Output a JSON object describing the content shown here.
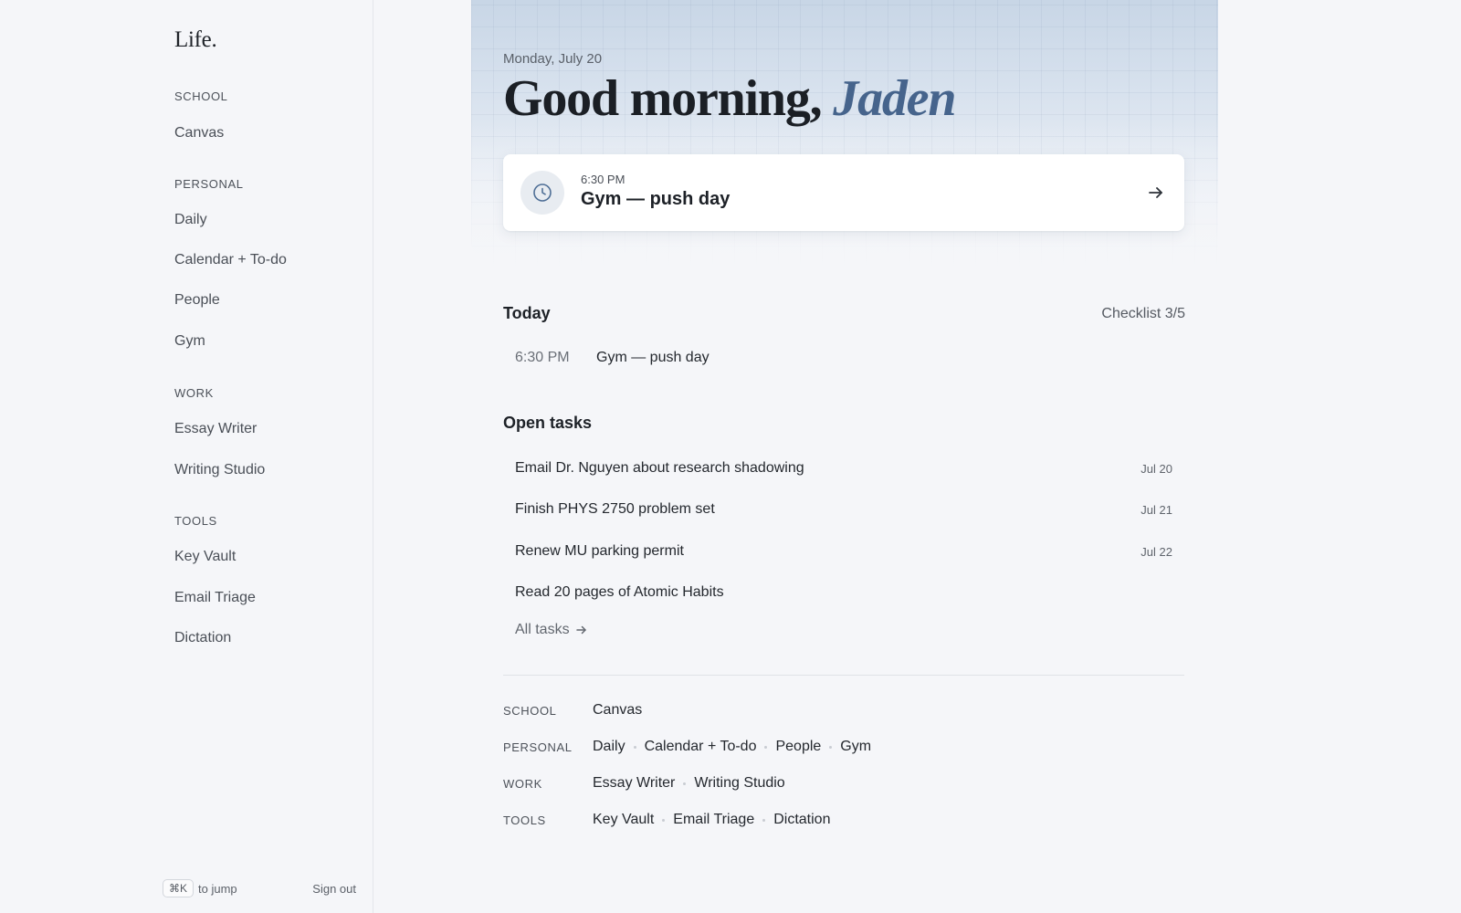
{
  "app": {
    "logo": "Life."
  },
  "sidebar": {
    "sections": [
      {
        "label": "SCHOOL",
        "items": [
          "Canvas"
        ]
      },
      {
        "label": "PERSONAL",
        "items": [
          "Daily",
          "Calendar + To-do",
          "People",
          "Gym"
        ]
      },
      {
        "label": "WORK",
        "items": [
          "Essay Writer",
          "Writing Studio"
        ]
      },
      {
        "label": "TOOLS",
        "items": [
          "Key Vault",
          "Email Triage",
          "Dictation"
        ]
      }
    ],
    "footer": {
      "shortcut_key": "⌘K",
      "shortcut_hint": "to jump",
      "sign_out": "Sign out"
    }
  },
  "hero": {
    "date": "Monday, July 20",
    "greeting": "Good morning,",
    "name": "Jaden",
    "next_event": {
      "time": "6:30 PM",
      "title": "Gym — push day",
      "icon": "clock-icon",
      "action_icon": "arrow-right-icon"
    }
  },
  "today": {
    "title": "Today",
    "checklist": "Checklist 3/5",
    "events": [
      {
        "time": "6:30 PM",
        "title": "Gym — push day"
      }
    ]
  },
  "tasks": {
    "title": "Open tasks",
    "items": [
      {
        "text": "Email Dr. Nguyen about research shadowing",
        "date": "Jul 20"
      },
      {
        "text": "Finish PHYS 2750 problem set",
        "date": "Jul 21"
      },
      {
        "text": "Renew MU parking permit",
        "date": "Jul 22"
      },
      {
        "text": "Read 20 pages of Atomic Habits",
        "date": ""
      }
    ],
    "all_tasks": "All tasks"
  },
  "directory": [
    {
      "label": "SCHOOL",
      "links": [
        "Canvas"
      ]
    },
    {
      "label": "PERSONAL",
      "links": [
        "Daily",
        "Calendar + To-do",
        "People",
        "Gym"
      ]
    },
    {
      "label": "WORK",
      "links": [
        "Essay Writer",
        "Writing Studio"
      ]
    },
    {
      "label": "TOOLS",
      "links": [
        "Key Vault",
        "Email Triage",
        "Dictation"
      ]
    }
  ],
  "colors": {
    "accent": "#46648c",
    "background": "#f5f6f9",
    "card": "#ffffff"
  }
}
